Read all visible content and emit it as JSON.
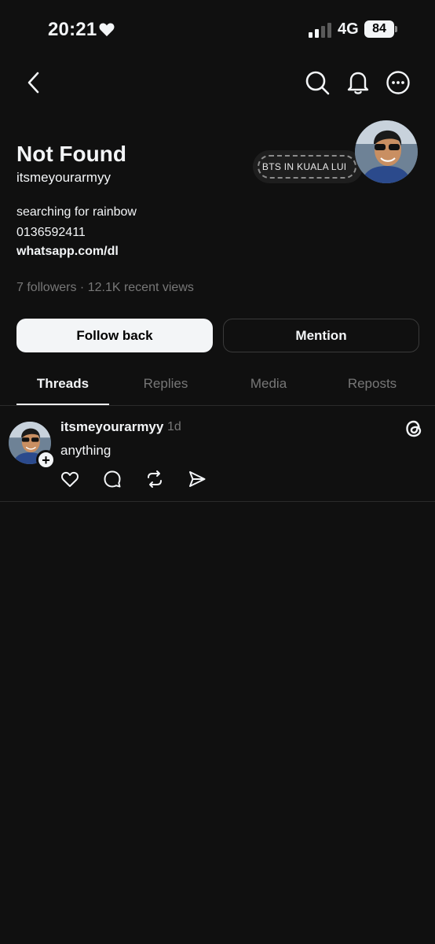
{
  "status_bar": {
    "time": "20:21",
    "network": "4G",
    "battery": "84"
  },
  "nav": {
    "back_icon": "chevron-left-icon",
    "search_icon": "search-icon",
    "notifications_icon": "bell-icon",
    "more_icon": "more-horizontal-icon"
  },
  "profile": {
    "name": "Not Found",
    "handle": "itsmeyourarmyy",
    "note": "r BTS IN KUALA LUI",
    "bio_lines": [
      "searching for rainbow",
      "0136592411"
    ],
    "link": "whatsapp.com/dl",
    "stats": "7 followers · 12.1K recent views"
  },
  "buttons": {
    "follow_back": "Follow back",
    "mention": "Mention"
  },
  "tabs": [
    {
      "label": "Threads",
      "active": true
    },
    {
      "label": "Replies",
      "active": false
    },
    {
      "label": "Media",
      "active": false
    },
    {
      "label": "Reposts",
      "active": false
    }
  ],
  "posts": [
    {
      "author": "itsmeyourarmyy",
      "time": "1d",
      "text": "anything",
      "actions": [
        "heart-icon",
        "comment-icon",
        "repost-icon",
        "send-icon"
      ]
    }
  ],
  "colors": {
    "background": "#101010",
    "text_primary": "#f3f5f7",
    "text_secondary": "#777777",
    "divider": "#2a2a2a"
  }
}
